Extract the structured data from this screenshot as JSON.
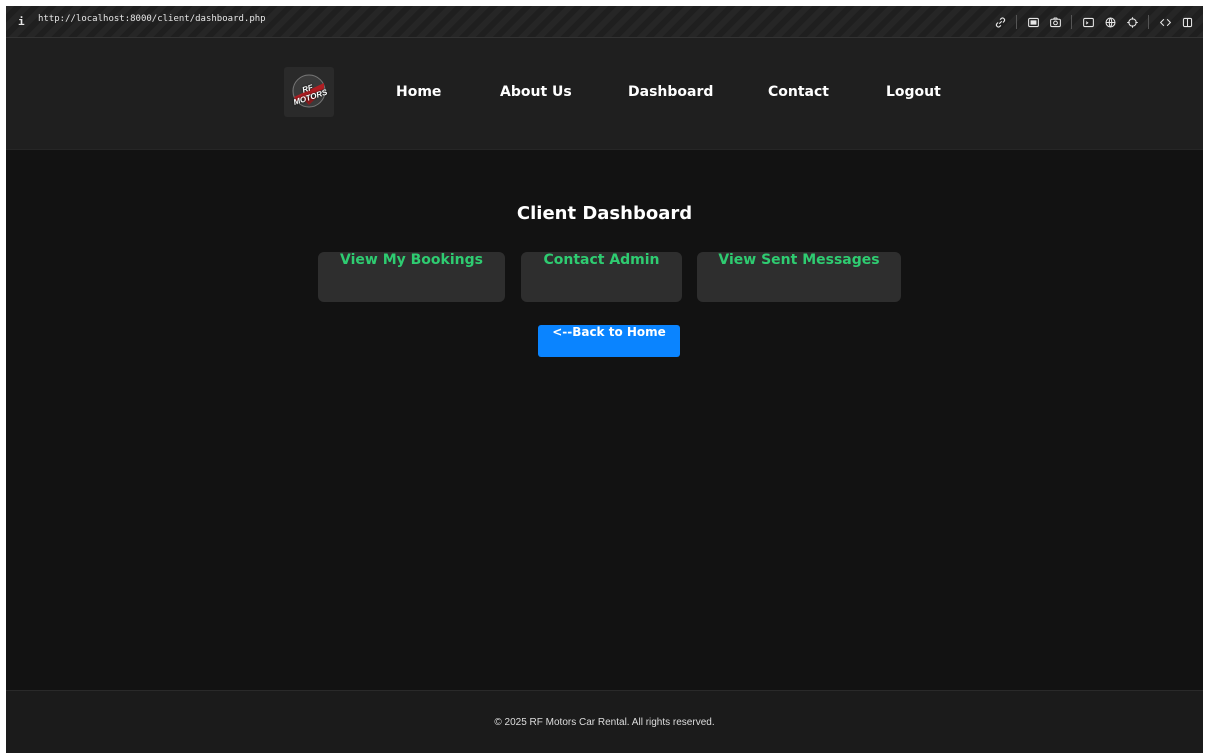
{
  "browser": {
    "info": "i",
    "url": "http://localhost:8000/client/dashboard.php",
    "icons": [
      "link-icon",
      "screenshot-icon",
      "camera-icon",
      "terminal-icon",
      "globe-icon",
      "crosshair-icon",
      "code-icon",
      "sidebar-icon"
    ]
  },
  "header": {
    "logo_text": "RF MOTORS",
    "nav": {
      "home": "Home",
      "about": "About Us",
      "dashboard": "Dashboard",
      "contact": "Contact",
      "logout": "Logout"
    }
  },
  "main": {
    "title": "Client Dashboard",
    "buttons": {
      "bookings": "View My Bookings",
      "contact_admin": "Contact Admin",
      "sent_messages": "View Sent Messages"
    },
    "back": "<--Back to Home"
  },
  "footer": {
    "text": "© 2025 RF Motors Car Rental. All rights reserved."
  },
  "colors": {
    "background": "#121212",
    "header": "#1f1f1f",
    "button": "#2e2e2e",
    "accent_green": "#2ecc71",
    "primary_blue": "#0a84ff"
  }
}
